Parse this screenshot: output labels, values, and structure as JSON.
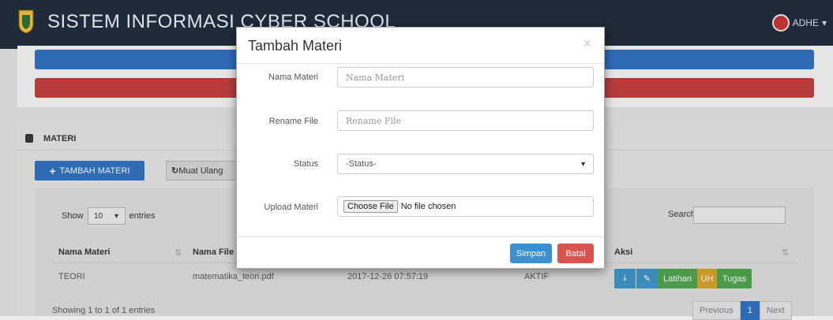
{
  "header": {
    "title": "SISTEM INFORMASI CYBER SCHOOL",
    "user": "ADHE"
  },
  "panel": {
    "title": "MATERI",
    "add_label": "TAMBAH MATERI",
    "reload_label": "Muat Ulang"
  },
  "table": {
    "show_label": "Show",
    "entries_value": "10",
    "entries_label": "entries",
    "search_label": "Search:",
    "columns": [
      "Nama Materi",
      "Nama File",
      "Aksi"
    ],
    "rows": [
      {
        "nama_materi": "TEORI",
        "nama_file": "matematika_teori.pdf",
        "tanggal": "2017-12-26 07:57:19",
        "status": "AKTIF"
      }
    ],
    "actions": {
      "download": "⤓",
      "edit": "✎",
      "latihan": "Latihan",
      "uh": "UH",
      "tugas": "Tugas"
    },
    "info": "Showing 1 to 1 of 1 entries",
    "pager": {
      "previous": "Previous",
      "page": "1",
      "next": "Next"
    }
  },
  "modal": {
    "title": "Tambah Materi",
    "close": "×",
    "fields": {
      "nama_materi": {
        "label": "Nama Materi",
        "placeholder": "Nama Materi"
      },
      "rename_file": {
        "label": "Rename File",
        "placeholder": "Rename File"
      },
      "status": {
        "label": "Status",
        "value": "-Status-"
      },
      "upload": {
        "label": "Upload Materi",
        "button": "Choose File",
        "value": "No file chosen"
      }
    },
    "save": "Simpan",
    "cancel": "Batal"
  }
}
